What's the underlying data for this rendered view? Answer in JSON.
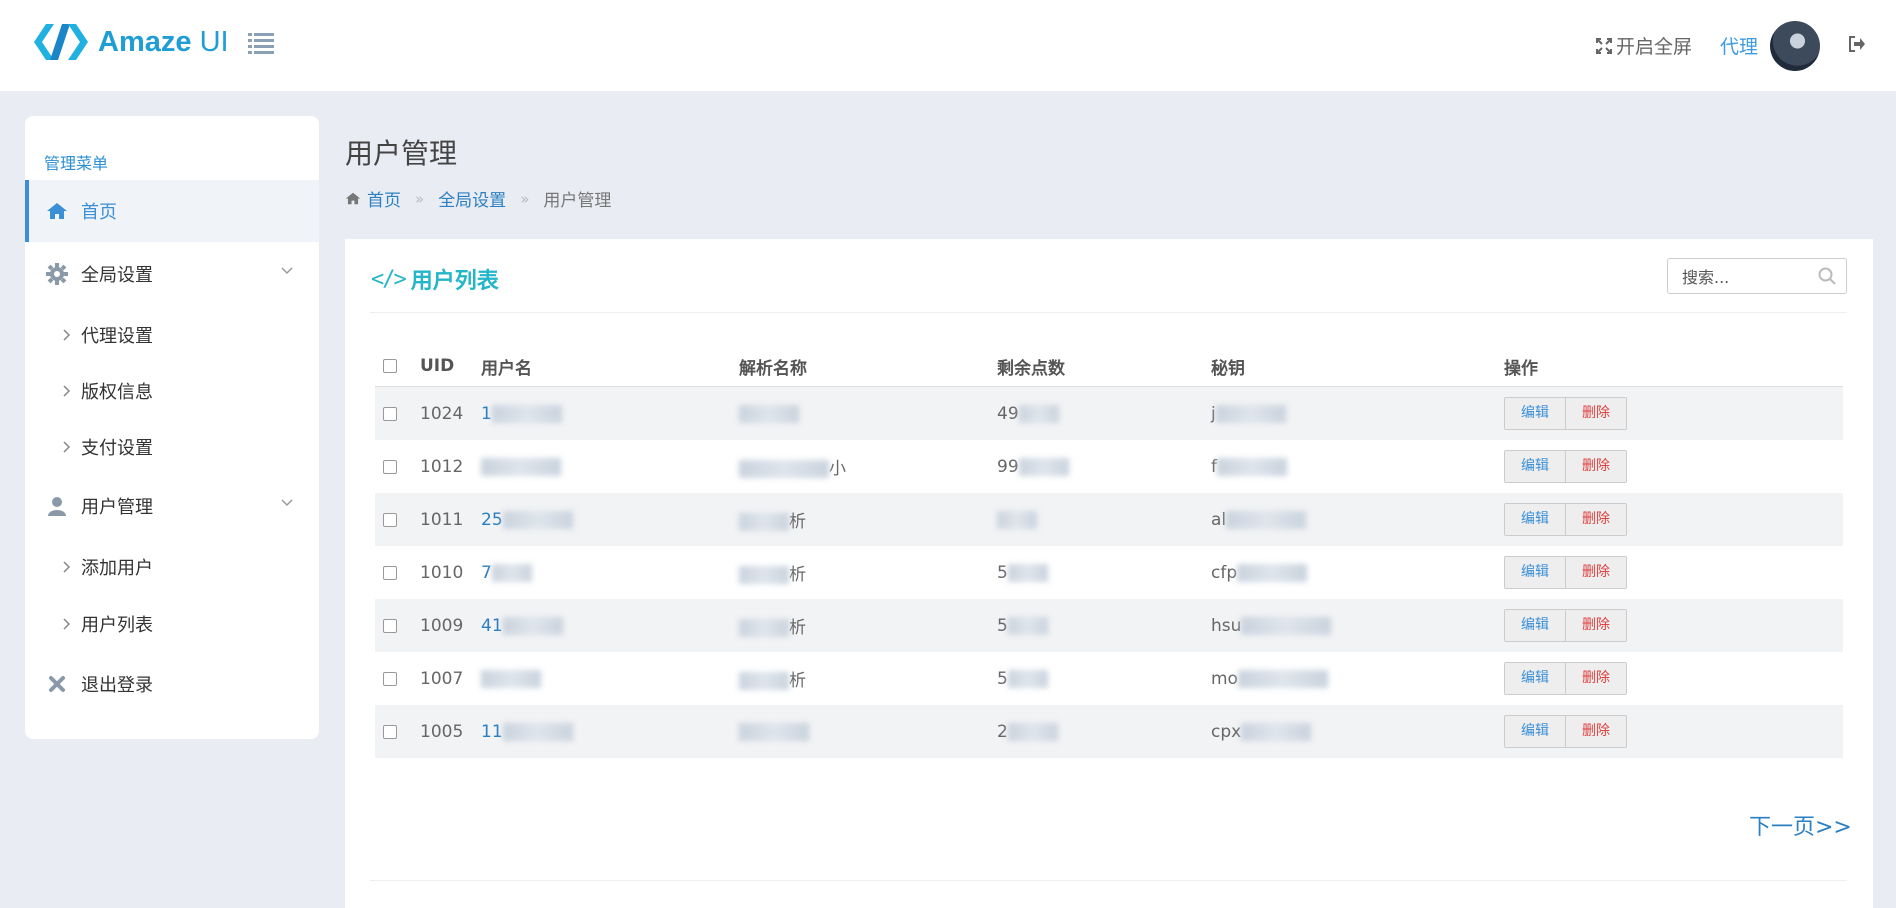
{
  "header": {
    "logo_word1": "Amaze",
    "logo_word2": "UI",
    "fullscreen_label": "开启全屏",
    "user_label": "代理"
  },
  "sidebar": {
    "title": "管理菜单",
    "items": [
      {
        "label": "首页",
        "icon": "home-icon"
      },
      {
        "label": "全局设置",
        "icon": "gear-icon"
      },
      {
        "label": "代理设置"
      },
      {
        "label": "版权信息"
      },
      {
        "label": "支付设置"
      },
      {
        "label": "用户管理",
        "icon": "user-icon"
      },
      {
        "label": "添加用户"
      },
      {
        "label": "用户列表"
      },
      {
        "label": "退出登录",
        "icon": "close-icon"
      }
    ]
  },
  "page": {
    "title": "用户管理",
    "breadcrumb": [
      "首页",
      "全局设置",
      "用户管理"
    ]
  },
  "panel": {
    "title": "用户列表",
    "search_placeholder": "搜索...",
    "next_page": "下一页>>"
  },
  "table": {
    "headers": [
      "UID",
      "用户名",
      "解析名称",
      "剩余点数",
      "秘钥",
      "操作"
    ],
    "rows": [
      {
        "uid": "1024",
        "username": "1",
        "parse_name": "",
        "points": "49",
        "key": "j",
        "edit": "编辑",
        "delete": "删除"
      },
      {
        "uid": "1012",
        "username": "",
        "parse_name": "小",
        "points": "99",
        "key": "f",
        "edit": "编辑",
        "delete": "删除"
      },
      {
        "uid": "1011",
        "username": "25",
        "parse_name": "析",
        "points": "",
        "key": "al",
        "edit": "编辑",
        "delete": "删除"
      },
      {
        "uid": "1010",
        "username": "7",
        "parse_name": "析",
        "points": "5",
        "key": "cfp",
        "edit": "编辑",
        "delete": "删除"
      },
      {
        "uid": "1009",
        "username": "41",
        "parse_name": "析",
        "points": "5",
        "key": "hsu",
        "edit": "编辑",
        "delete": "删除"
      },
      {
        "uid": "1007",
        "username": "",
        "parse_name": "析",
        "points": "5",
        "key": "mo",
        "edit": "编辑",
        "delete": "删除"
      },
      {
        "uid": "1005",
        "username": "11",
        "parse_name": "",
        "points": "2",
        "key": "cpx",
        "edit": "编辑",
        "delete": "删除"
      }
    ]
  }
}
